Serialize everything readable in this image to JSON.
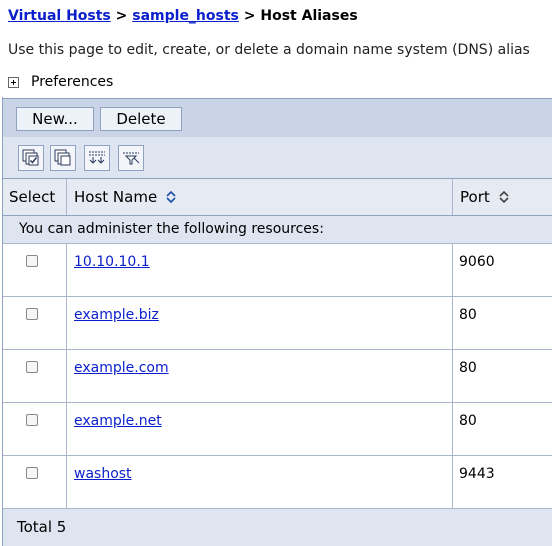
{
  "breadcrumb": {
    "items": [
      "Virtual Hosts",
      "sample_hosts",
      "Host Aliases"
    ],
    "separator": ">"
  },
  "description": "Use this page to edit, create, or delete a domain name system (DNS) alias",
  "preferences_label": "Preferences",
  "toolbar": {
    "new_label": "New...",
    "delete_label": "Delete"
  },
  "icon_buttons": [
    "select-all-icon",
    "deselect-all-icon",
    "show-filter-icon",
    "clear-filter-icon"
  ],
  "table": {
    "columns": [
      "Select",
      "Host Name",
      "Port"
    ],
    "info_text": "You can administer the following resources:",
    "rows": [
      {
        "host": "10.10.10.1",
        "port": "9060"
      },
      {
        "host": "example.biz",
        "port": "80"
      },
      {
        "host": "example.com",
        "port": "80"
      },
      {
        "host": "example.net",
        "port": "80"
      },
      {
        "host": "washost",
        "port": "9443"
      }
    ],
    "total_label": "Total 5"
  },
  "colors": {
    "link": "#0a1fcc",
    "toolbar_bg": "#c9d4e6",
    "header_bg": "#e6eaf2",
    "border": "#8ea3c2"
  }
}
